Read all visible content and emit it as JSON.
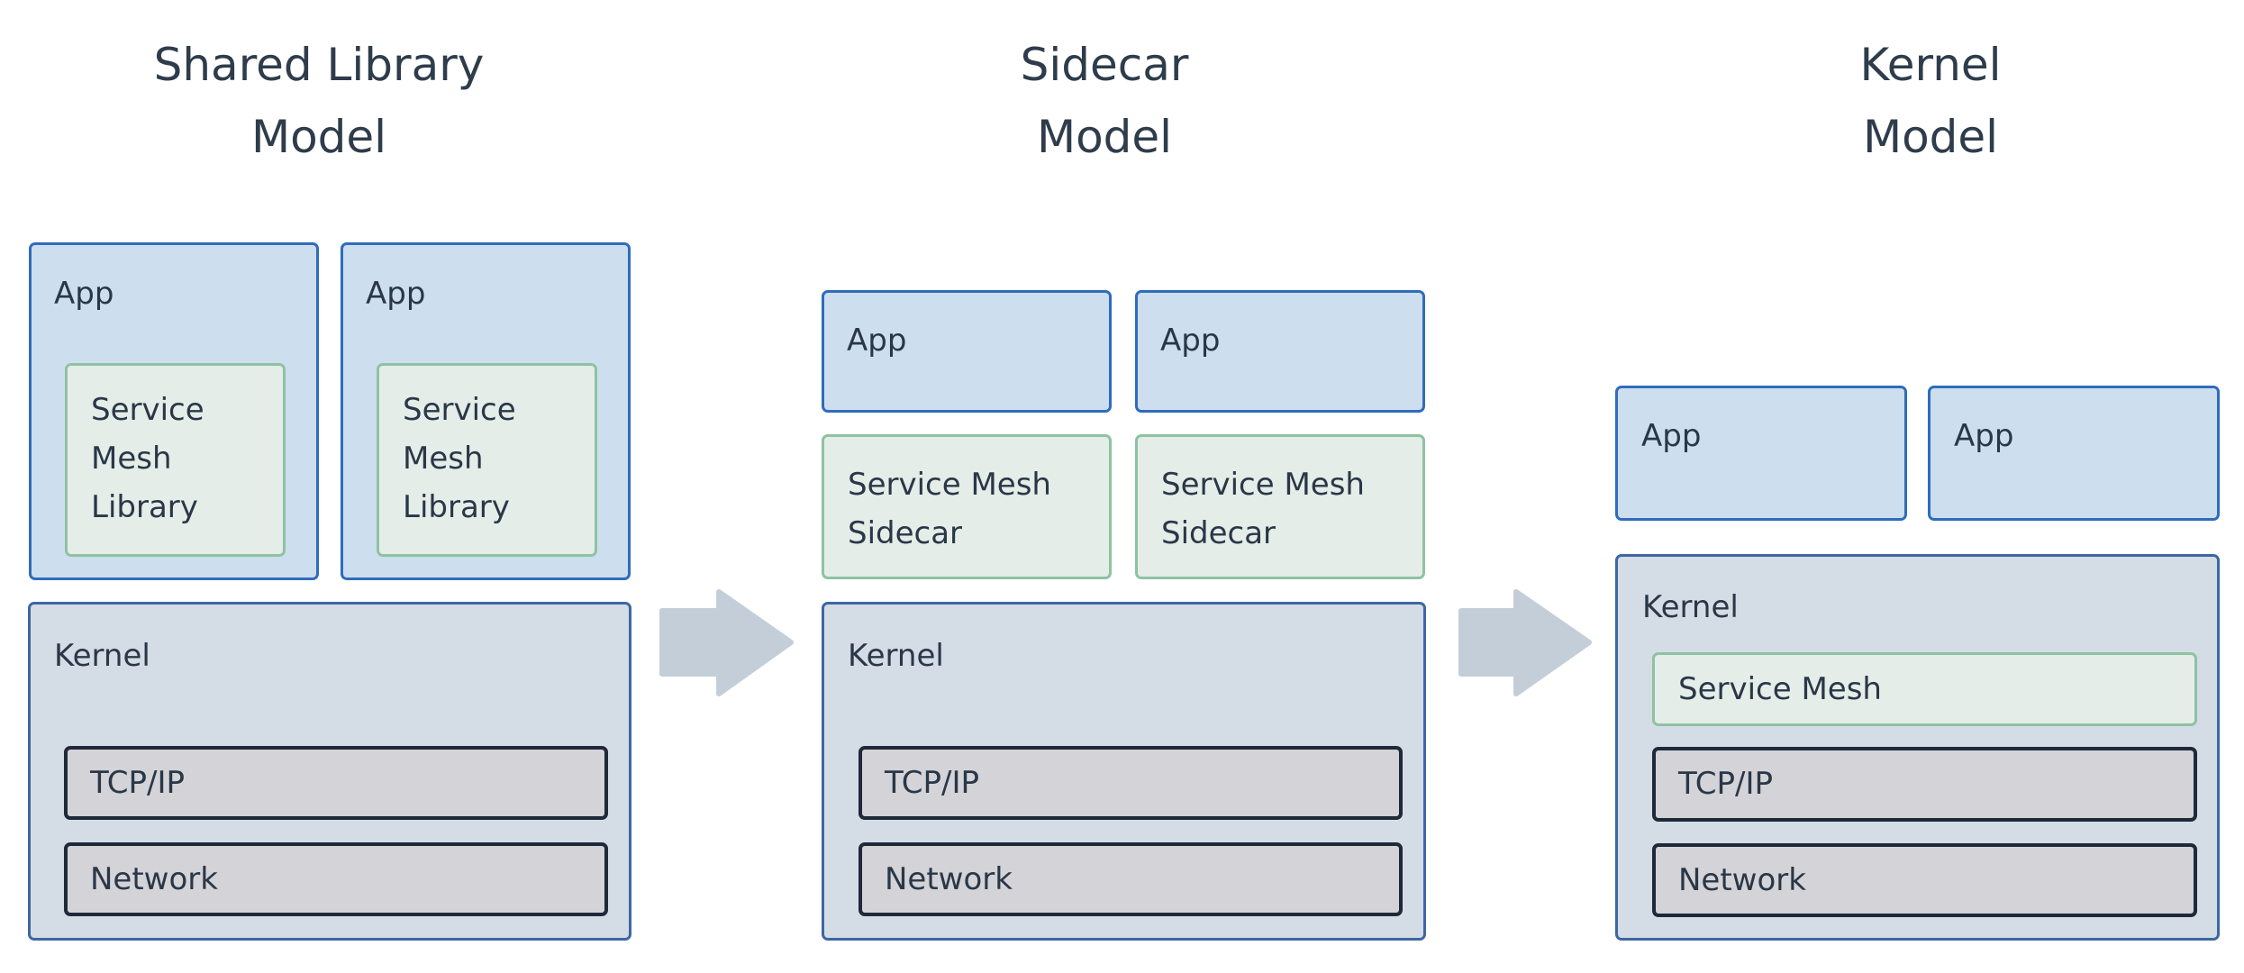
{
  "diagram": {
    "columns": [
      {
        "title": "Shared Library\nModel",
        "apps": [
          {
            "label": "App",
            "embedded": "Service\nMesh\nLibrary"
          },
          {
            "label": "App",
            "embedded": "Service\nMesh\nLibrary"
          }
        ],
        "kernel": {
          "label": "Kernel",
          "layers": [
            "TCP/IP",
            "Network"
          ]
        }
      },
      {
        "title": "Sidecar\nModel",
        "apps": [
          {
            "label": "App"
          },
          {
            "label": "App"
          }
        ],
        "sidecars": [
          "Service Mesh\nSidecar",
          "Service Mesh\nSidecar"
        ],
        "kernel": {
          "label": "Kernel",
          "layers": [
            "TCP/IP",
            "Network"
          ]
        }
      },
      {
        "title": "Kernel\nModel",
        "apps": [
          {
            "label": "App"
          },
          {
            "label": "App"
          }
        ],
        "kernel": {
          "label": "Kernel",
          "layers": [
            "Service Mesh",
            "TCP/IP",
            "Network"
          ]
        }
      }
    ],
    "arrows": [
      {
        "from": "Shared Library Model",
        "to": "Sidecar Model",
        "icon": "right-arrow-icon"
      },
      {
        "from": "Sidecar Model",
        "to": "Kernel Model",
        "icon": "right-arrow-icon"
      }
    ],
    "colors": {
      "app_fill": "#cddeee",
      "app_border": "#2f6cbc",
      "mesh_fill": "#e4ede8",
      "mesh_border": "#8fc2a2",
      "kernel_fill": "#d4dce6",
      "kernel_border": "#3e66a3",
      "layer_fill": "#d3d3d8",
      "layer_border": "#1e293a",
      "arrow": "#c3ced8",
      "text": "#2e3c4b"
    }
  }
}
